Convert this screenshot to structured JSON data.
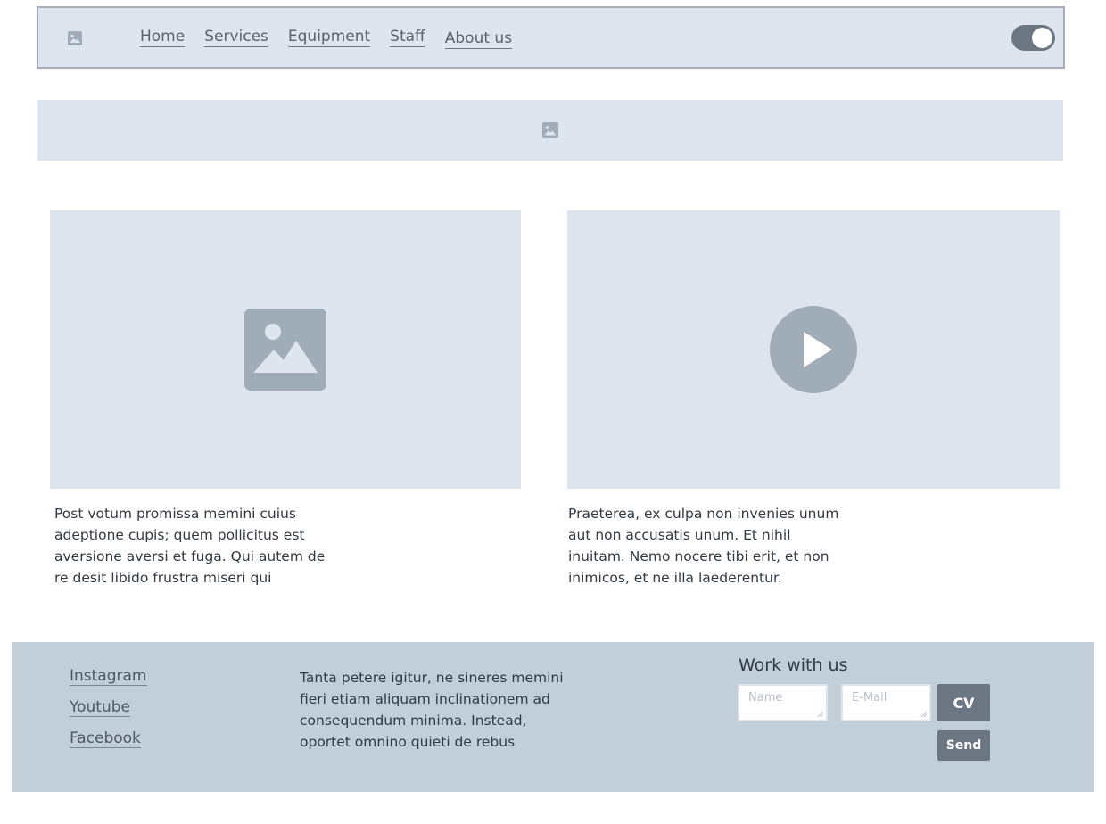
{
  "nav": {
    "logo_icon": "image-placeholder-icon",
    "items": [
      "Home",
      "Services",
      "Equipment",
      "Staff",
      "About us"
    ],
    "toggle_state": "on"
  },
  "banner": {
    "icon": "image-placeholder-icon"
  },
  "media": {
    "left": {
      "icon": "image-placeholder-icon",
      "caption": "Post votum promissa memini cuius adeptione cupis; quem pollicitus est aversione aversi et fuga. Qui autem de re desit libido frustra miseri qui"
    },
    "right": {
      "icon": "play-icon",
      "caption": "Praeterea, ex culpa non invenies unum aut non accusatis unum. Et nihil inuitam. Nemo nocere tibi erit, et non inimicos, et ne illa laederentur."
    }
  },
  "footer": {
    "social": [
      "Instagram",
      "Youtube",
      "Facebook"
    ],
    "text": "Tanta petere igitur, ne sineres memini fieri etiam aliquam inclinationem ad consequendum minima. Instead, oportet omnino quieti de rebus",
    "work_title": "Work with us",
    "name_placeholder": "Name",
    "email_placeholder": "E-Mail",
    "cv_label": "CV",
    "send_label": "Send"
  },
  "colors": {
    "placeholder_bg": "#dfe5ee",
    "icon_grey": "#a0adb9",
    "accent": "#6b7682",
    "footer_bg": "#c2ced8"
  }
}
